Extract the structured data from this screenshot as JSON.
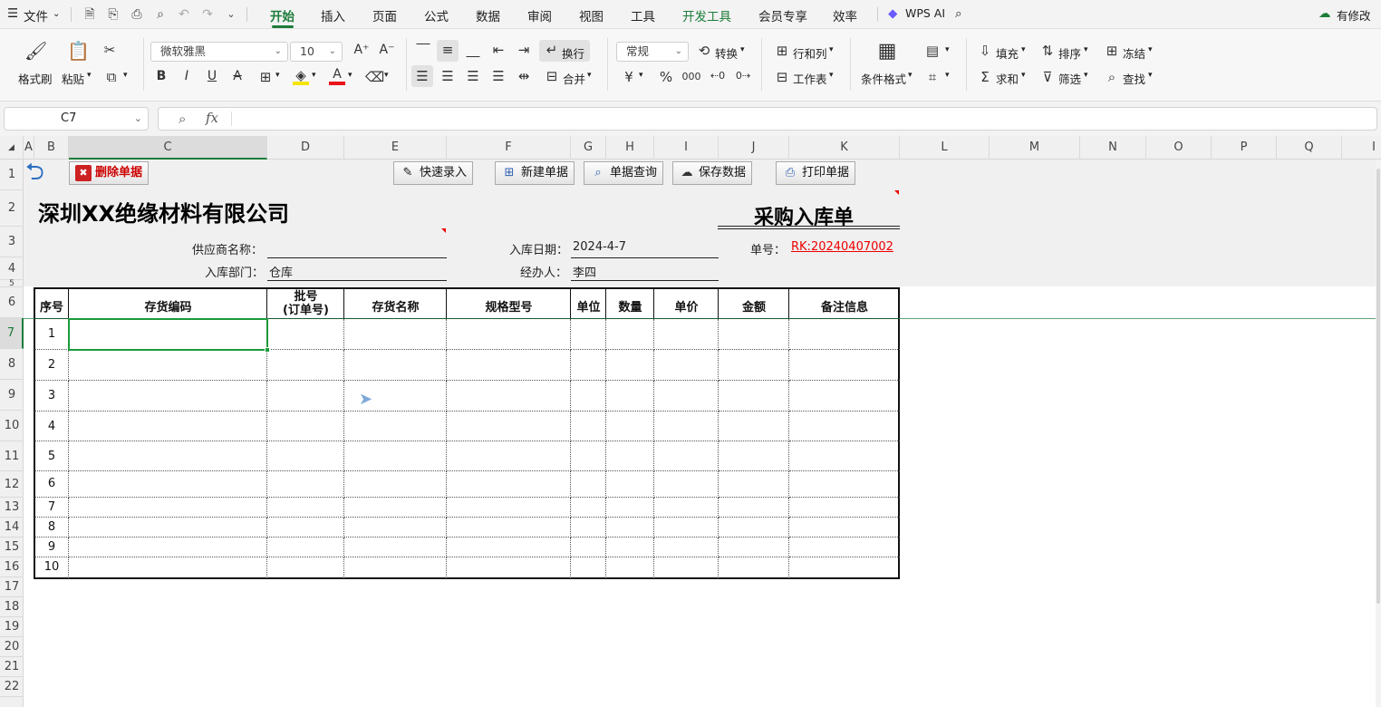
{
  "menubar": {
    "file_label": "文件",
    "tabs": [
      "开始",
      "插入",
      "页面",
      "公式",
      "数据",
      "审阅",
      "视图",
      "工具",
      "开发工具",
      "会员专享",
      "效率"
    ],
    "active_tab": "开始",
    "wps_ai": "WPS AI",
    "status_right": "有修改"
  },
  "ribbon": {
    "format_painter": "格式刷",
    "paste": "粘贴",
    "font_name": "微软雅黑",
    "font_size": "10",
    "wrap": "换行",
    "merge": "合并",
    "number_format": "常规",
    "convert": "转换",
    "row_col": "行和列",
    "worksheet": "工作表",
    "cond_format": "条件格式",
    "fill": "填充",
    "sort": "排序",
    "freeze": "冻结",
    "sum": "求和",
    "filter": "筛选",
    "find": "查找",
    "currency_symbol": "¥",
    "percent_symbol": "%",
    "thousands": "000",
    "fx_label": "fx",
    "font_color": "#e8141b",
    "fill_color": "#f5e400"
  },
  "formula_bar": {
    "cell_ref": "C7",
    "formula": ""
  },
  "columns": [
    "A",
    "B",
    "C",
    "D",
    "E",
    "F",
    "G",
    "H",
    "I",
    "J",
    "K",
    "L",
    "M",
    "N",
    "O",
    "P",
    "Q",
    "I"
  ],
  "rows": [
    "1",
    "2",
    "3",
    "4",
    "5",
    "6",
    "7",
    "8",
    "9",
    "10",
    "11",
    "12",
    "13",
    "14",
    "15",
    "16",
    "17",
    "18",
    "19",
    "20",
    "21",
    "22"
  ],
  "toolbar_buttons": {
    "delete": "删除单据",
    "quick_entry": "快速录入",
    "new_doc": "新建单据",
    "query": "单据查询",
    "save": "保存数据",
    "print": "打印单据"
  },
  "form": {
    "company": "深圳XX绝缘材料有限公司",
    "title": "采购入库单",
    "supplier_label": "供应商名称：",
    "supplier_value": "",
    "date_label": "入库日期：",
    "date_value": "2024-4-7",
    "doc_no_label": "单号：",
    "doc_no_value": "RK:20240407002",
    "dept_label": "入库部门：",
    "dept_value": "仓库",
    "handler_label": "经办人：",
    "handler_value": "李四"
  },
  "table": {
    "headers": [
      "序号",
      "存货编码",
      "批号\n(订单号)",
      "存货名称",
      "规格型号",
      "单位",
      "数量",
      "单价",
      "金额",
      "备注信息"
    ],
    "row_numbers": [
      "1",
      "2",
      "3",
      "4",
      "5",
      "6",
      "7",
      "8",
      "9",
      "10"
    ]
  }
}
